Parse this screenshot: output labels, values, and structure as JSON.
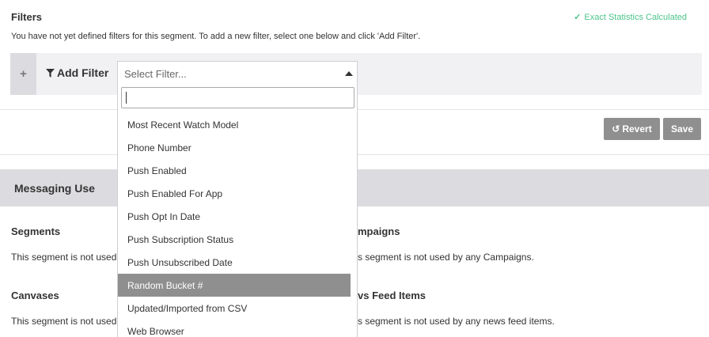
{
  "filters": {
    "title": "Filters",
    "exact_stats": "Exact Statistics Calculated",
    "description": "You have not yet defined filters for this segment. To add a new filter, select one below and click 'Add Filter'.",
    "plus_glyph": "+",
    "add_filter_label": "Add Filter",
    "select_placeholder": "Select Filter...",
    "search_value": ""
  },
  "dropdown": {
    "items": [
      "Most Recent Watch Model",
      "Phone Number",
      "Push Enabled",
      "Push Enabled For App",
      "Push Opt In Date",
      "Push Subscription Status",
      "Push Unsubscribed Date",
      "Random Bucket #",
      "Updated/Imported from CSV",
      "Web Browser"
    ],
    "highlighted": "Random Bucket #"
  },
  "actions": {
    "revert_label": "Revert",
    "save_label": "Save"
  },
  "messaging": {
    "title": "Messaging Use",
    "segments_title": "Segments",
    "segments_text": "This segment is not used",
    "campaigns_title": "mpaigns",
    "campaigns_text": "s segment is not used by any Campaigns.",
    "canvases_title": "Canvases",
    "canvases_text": "This segment is not used",
    "newsfeed_title": "vs Feed Items",
    "newsfeed_text": "s segment is not used by any news feed items."
  },
  "colors": {
    "accent_green": "#4cc48a",
    "button_gray": "#8f8f8f",
    "band_gray": "#dcdce0"
  }
}
